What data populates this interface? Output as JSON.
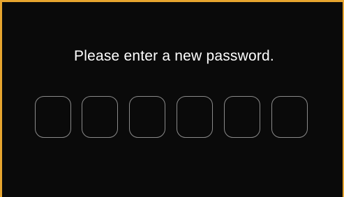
{
  "prompt": {
    "text": "Please enter a new password."
  },
  "pin": {
    "length": 6,
    "digits": [
      "",
      "",
      "",
      "",
      "",
      ""
    ]
  },
  "colors": {
    "frame_accent": "#e7a52f",
    "background": "#0a0a0a",
    "box_border": "#8a8a8a",
    "text": "#ffffff"
  }
}
